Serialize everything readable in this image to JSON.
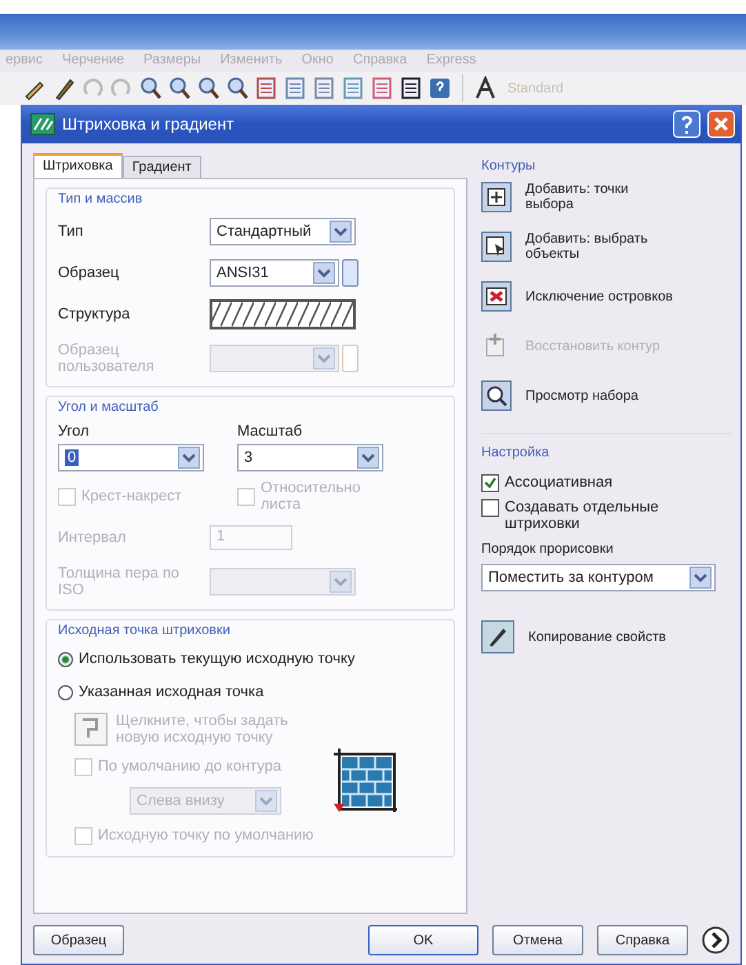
{
  "menu": [
    "ервис",
    "Черчение",
    "Размеры",
    "Изменить",
    "Окно",
    "Справка",
    "Express"
  ],
  "toolbar": {
    "style_label": "Standard"
  },
  "dialog": {
    "title": "Штриховка и градиент",
    "tabs": [
      {
        "label": "Штриховка",
        "selected": true
      },
      {
        "label": "Градиент",
        "selected": false
      }
    ],
    "type_group": {
      "title": "Тип и массив",
      "type": {
        "label": "Тип",
        "value": "Стандартный"
      },
      "pattern": {
        "label": "Образец",
        "value": "ANSI31"
      },
      "swatch": {
        "label": "Структура"
      },
      "custom": {
        "label": "Образец пользователя",
        "disabled": true
      }
    },
    "angle_group": {
      "title": "Угол и масштаб",
      "angle": {
        "label": "Угол",
        "value": "0"
      },
      "scale": {
        "label": "Масштаб",
        "value": "3"
      },
      "double": {
        "label": "Крест-накрест",
        "checked": false,
        "disabled": true
      },
      "relative": {
        "label": "Относительно листа",
        "checked": false,
        "disabled": true
      },
      "spacing": {
        "label": "Интервал",
        "value": "1",
        "disabled": true
      },
      "pen": {
        "label": "Толщина пера по ISO",
        "disabled": true
      }
    },
    "origin_group": {
      "title": "Исходная точка штриховки",
      "radios": [
        {
          "label": "Использовать текущую исходную точку",
          "selected": true
        },
        {
          "label": "Указанная исходная точка",
          "selected": false
        }
      ],
      "pick": {
        "label": "Щелкните, чтобы задать новую исходную точку",
        "disabled": true
      },
      "default_extents": {
        "label": "По умолчанию до контура",
        "checked": false,
        "disabled": true
      },
      "position": {
        "value": "Слева внизу",
        "disabled": true
      },
      "store": {
        "label": "Исходную точку по умолчанию",
        "checked": false,
        "disabled": true
      }
    },
    "boundaries": {
      "title": "Контуры",
      "actions": [
        {
          "kind": "pick",
          "label": "Добавить: точки выбора",
          "disabled": false
        },
        {
          "kind": "select",
          "label": "Добавить: выбрать объекты",
          "disabled": false
        },
        {
          "kind": "remove",
          "label": "Исключение островков",
          "disabled": false
        },
        {
          "kind": "recreate",
          "label": "Восстановить контур",
          "disabled": true
        },
        {
          "kind": "view",
          "label": "Просмотр набора",
          "disabled": false
        }
      ]
    },
    "options": {
      "title": "Настройка",
      "associative": {
        "label": "Ассоциативная",
        "checked": true
      },
      "separate": {
        "label": "Создавать отдельные штриховки",
        "checked": false
      },
      "draw_order": {
        "label": "Порядок прорисовки",
        "value": "Поместить за контуром"
      }
    },
    "inherit": {
      "label": "Копирование свойств"
    },
    "buttons": [
      {
        "label": "Образец"
      },
      {
        "label": "OK"
      },
      {
        "label": "Отмена"
      },
      {
        "label": "Справка"
      }
    ]
  }
}
